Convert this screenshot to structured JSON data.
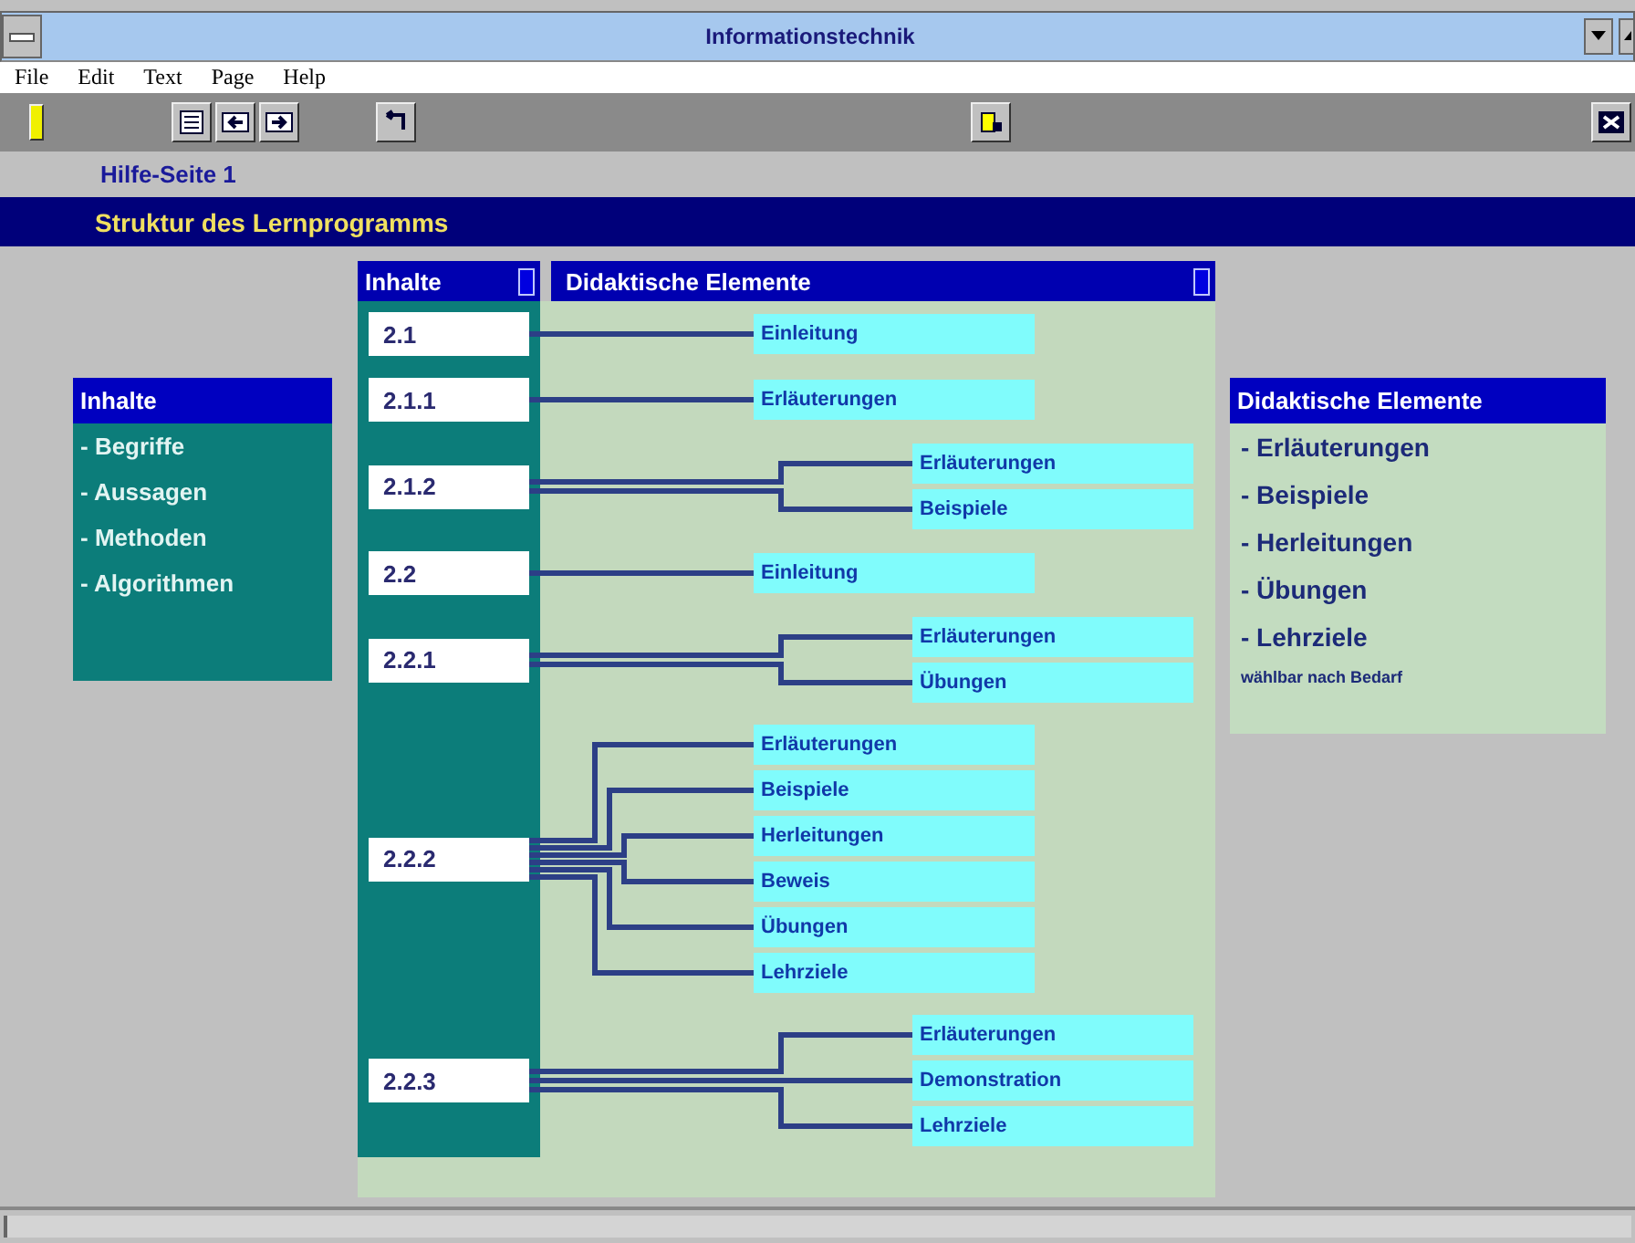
{
  "window": {
    "title": "Informationstechnik"
  },
  "menu": [
    "File",
    "Edit",
    "Text",
    "Page",
    "Help"
  ],
  "page_label": "Hilfe-Seite 1",
  "heading": "Struktur des Lernprogramms",
  "contents_box": {
    "title": "Inhalte",
    "items": [
      "- Begriffe",
      "- Aussagen",
      "- Methoden",
      "- Algorithmen"
    ]
  },
  "structure": {
    "left_header": "Inhalte",
    "right_header": "Didaktische Elemente",
    "sections": [
      {
        "number": "2.1",
        "kind": "single",
        "elements": [
          "Einleitung"
        ]
      },
      {
        "number": "2.1.1",
        "kind": "single",
        "elements": [
          "Erläuterungen"
        ]
      },
      {
        "number": "2.1.2",
        "kind": "fork",
        "elements": [
          "Erläuterungen",
          "Beispiele"
        ]
      },
      {
        "number": "2.2",
        "kind": "single",
        "elements": [
          "Einleitung"
        ]
      },
      {
        "number": "2.2.1",
        "kind": "fork",
        "elements": [
          "Erläuterungen",
          "Übungen"
        ]
      },
      {
        "number": "2.2.2",
        "kind": "fan",
        "elements": [
          "Erläuterungen",
          "Beispiele",
          "Herleitungen",
          "Beweis",
          "Übungen",
          "Lehrziele"
        ]
      },
      {
        "number": "2.2.3",
        "kind": "fork",
        "elements": [
          "Erläuterungen",
          "Demonstration",
          "Lehrziele"
        ]
      }
    ]
  },
  "elements_box": {
    "title": "Didaktische Elemente",
    "items": [
      "- Erläuterungen",
      "- Beispiele",
      "- Herleitungen",
      "- Übungen",
      "- Lehrziele"
    ],
    "note": "wählbar nach Bedarf"
  }
}
